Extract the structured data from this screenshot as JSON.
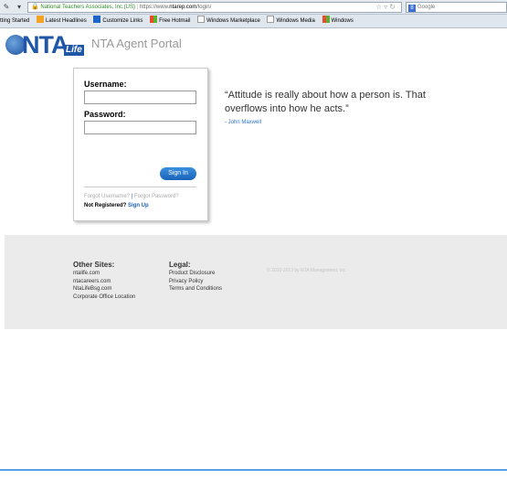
{
  "browser": {
    "address_site": "National Teachers Associates, Inc.(US)",
    "address_prefix": "https://www.",
    "address_host": "ntarep.com",
    "address_path": "/login/",
    "search_placeholder": "Google",
    "bookmarks": [
      {
        "label": "tting Started",
        "icon": "page-icon"
      },
      {
        "label": "Latest Headlines",
        "icon": "rss-icon"
      },
      {
        "label": "Customize Links",
        "icon": "ie-icon"
      },
      {
        "label": "Free Hotmail",
        "icon": "windows-icon"
      },
      {
        "label": "Windows Marketplace",
        "icon": "page-icon"
      },
      {
        "label": "Windows Media",
        "icon": "page-icon"
      },
      {
        "label": "Windows",
        "icon": "windows-icon"
      }
    ]
  },
  "header": {
    "logo_text": "NTA",
    "logo_sub": "Life",
    "title": "NTA Agent Portal"
  },
  "login": {
    "username_label": "Username:",
    "password_label": "Password:",
    "username_value": "",
    "password_value": "",
    "signin_label": "Sign In",
    "forgot_username": "Forgot Username?",
    "forgot_password": "Forgot Password?",
    "separator": "|",
    "not_registered": "Not Registered?",
    "signup": "Sign Up"
  },
  "quote": {
    "text": "“Attitude is really about how a person is. That overflows into how he acts.”",
    "author": "- John Maxwell"
  },
  "footer": {
    "other_sites_title": "Other Sites:",
    "other_sites": [
      "ntalife.com",
      "ntacareers.com",
      "NtaLifeBsg.com",
      "Corporate Office Location"
    ],
    "legal_title": "Legal:",
    "legal": [
      "Product Disclosure",
      "Privacy Policy",
      "Terms and Conditions"
    ],
    "copyright": "© 2010-2013 by NTA Management, Inc."
  },
  "colors": {
    "brand_blue": "#1f56a8",
    "link_blue": "#1a63b8",
    "footer_bg": "#ebebeb"
  }
}
